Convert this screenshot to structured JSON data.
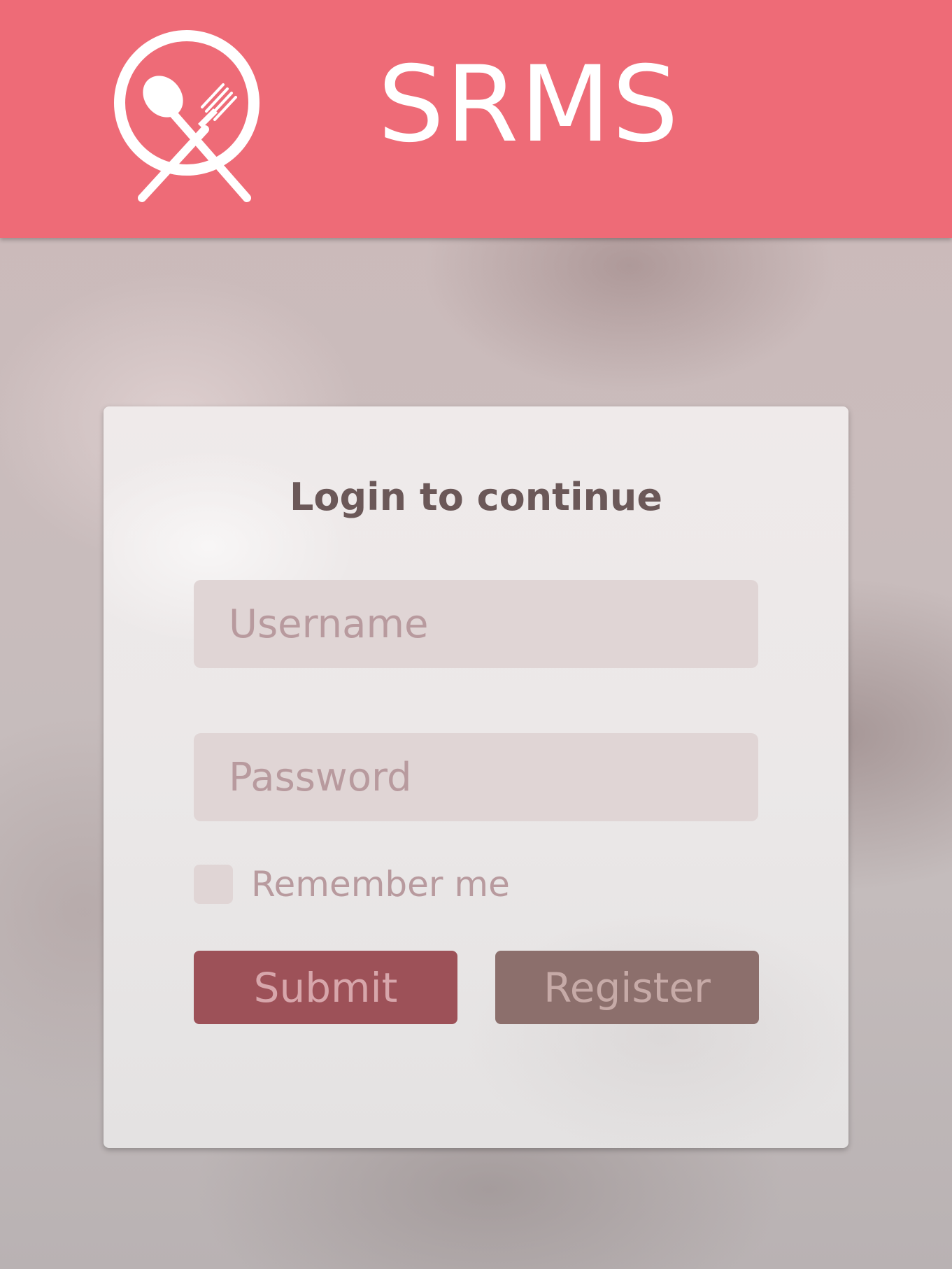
{
  "header": {
    "title": "SRMS",
    "logo_icon": "plate-spoon-fork-icon",
    "background_color": "#ee6b77"
  },
  "login": {
    "heading": "Login to continue",
    "username": {
      "placeholder": "Username",
      "value": ""
    },
    "password": {
      "placeholder": "Password",
      "value": ""
    },
    "remember": {
      "label": "Remember me",
      "checked": false
    },
    "submit_label": "Submit",
    "register_label": "Register"
  },
  "colors": {
    "submit": "#9d5158",
    "register": "#8c6f6c",
    "input_bg": "#e0d5d5"
  }
}
